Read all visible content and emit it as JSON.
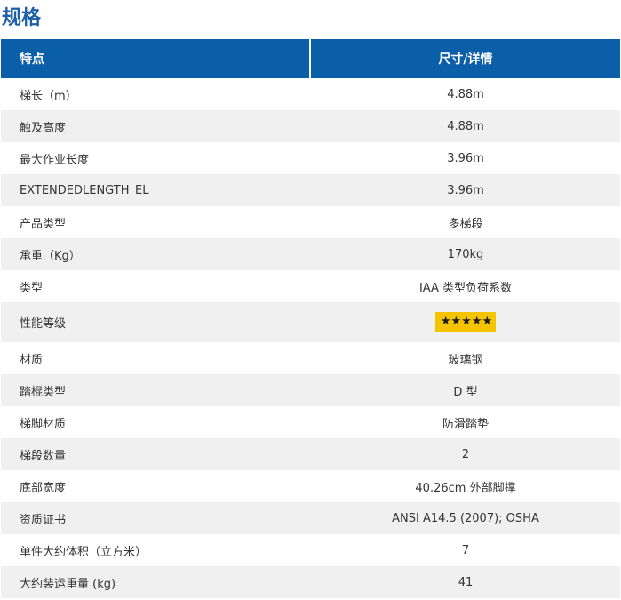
{
  "title": "规格",
  "header": {
    "feature": "特点",
    "detail": "尺寸/详情"
  },
  "rows": [
    {
      "label": "梯长（m）",
      "value": "4.88m"
    },
    {
      "label": "触及高度",
      "value": "4.88m"
    },
    {
      "label": "最大作业长度",
      "value": "3.96m"
    },
    {
      "label": "EXTENDEDLENGTH_EL",
      "value": "3.96m"
    },
    {
      "label": "产品类型",
      "value": "多梯段"
    },
    {
      "label": "承重（Kg）",
      "value": "170kg"
    },
    {
      "label": "类型",
      "value": "IAA 类型负荷系数"
    },
    {
      "label": "性能等级",
      "value": "★★★★★",
      "rating": 5,
      "rating_max": 5
    },
    {
      "label": "材质",
      "value": "玻璃钢"
    },
    {
      "label": "踏棍类型",
      "value": "D 型"
    },
    {
      "label": "梯脚材质",
      "value": "防滑踏垫"
    },
    {
      "label": "梯段数量",
      "value": "2"
    },
    {
      "label": "底部宽度",
      "value": "40.26cm 外部脚撑"
    },
    {
      "label": "资质证书",
      "value": "ANSI A14.5 (2007); OSHA"
    },
    {
      "label": "单件大约体积（立方米）",
      "value": "7"
    },
    {
      "label": "大约装运重量 (kg)",
      "value": "41"
    }
  ],
  "colors": {
    "title": "#1d5fa8",
    "header_bg": "#0b5ea8",
    "row_shade": "#f0f0f0",
    "rating_bg": "#f5c400"
  }
}
